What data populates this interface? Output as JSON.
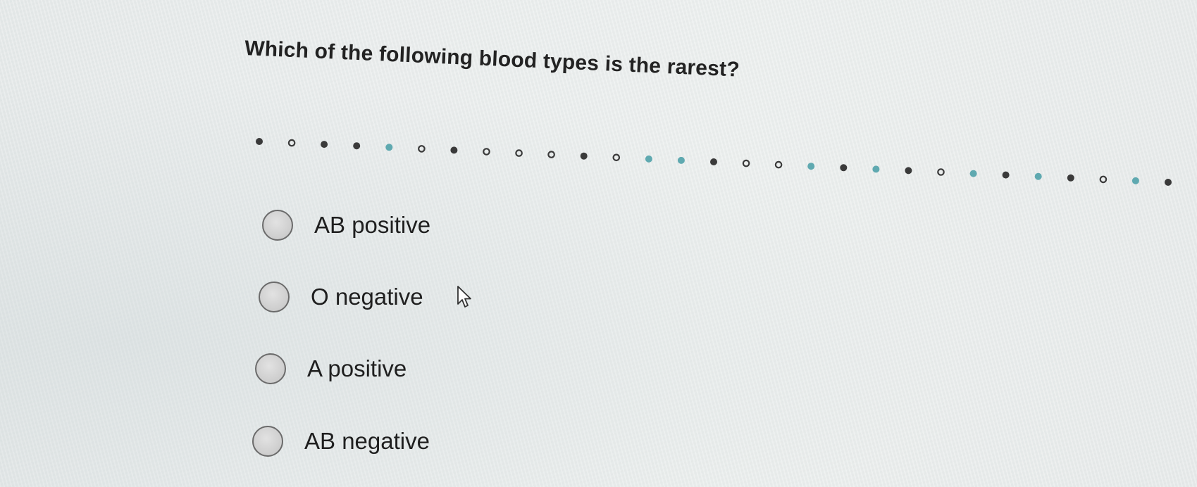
{
  "question": {
    "text": "Which of the following blood types is the rarest?"
  },
  "options": [
    {
      "label": "AB positive",
      "selected": false
    },
    {
      "label": "O negative",
      "selected": false
    },
    {
      "label": "A positive",
      "selected": false
    },
    {
      "label": "AB negative",
      "selected": false
    }
  ],
  "colors": {
    "dot_dark": "#3a3a3a",
    "dot_teal": "#5fa9b0",
    "dot_hollow_stroke": "#3a3a3a",
    "radio_fill": "#d3d3d3",
    "radio_border": "#6b6b6b",
    "text": "#1f1f1f"
  },
  "icons": {
    "cursor": "mouse-pointer-arrow-icon",
    "radio": "radio-button-icon"
  }
}
